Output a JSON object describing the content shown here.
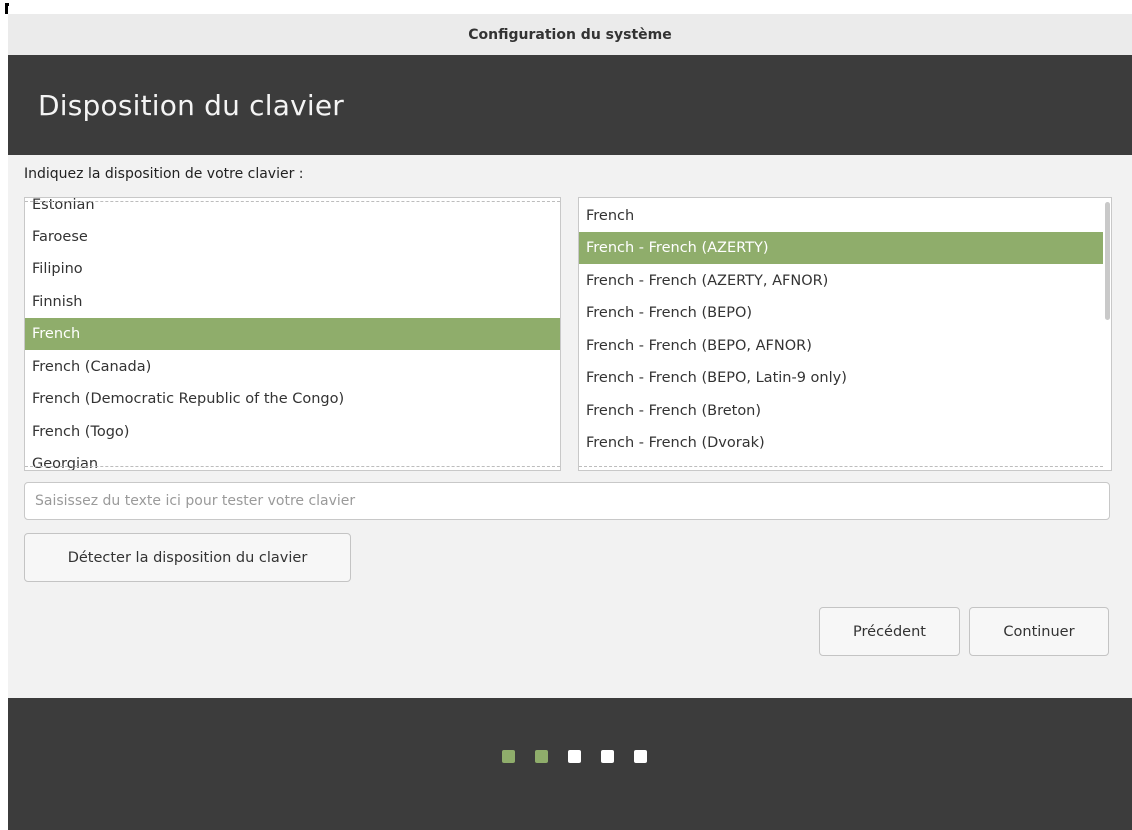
{
  "window": {
    "title": "Configuration du système"
  },
  "header": {
    "title": "Disposition du clavier"
  },
  "prompt": "Indiquez la disposition de votre clavier :",
  "layouts": {
    "items": [
      {
        "label": "Estonian",
        "selected": false
      },
      {
        "label": "Faroese",
        "selected": false
      },
      {
        "label": "Filipino",
        "selected": false
      },
      {
        "label": "Finnish",
        "selected": false
      },
      {
        "label": "French",
        "selected": true
      },
      {
        "label": "French (Canada)",
        "selected": false
      },
      {
        "label": "French (Democratic Republic of the Congo)",
        "selected": false
      },
      {
        "label": "French (Togo)",
        "selected": false
      },
      {
        "label": "Georgian",
        "selected": false
      }
    ]
  },
  "variants": {
    "items": [
      {
        "label": "French",
        "selected": false
      },
      {
        "label": "French - French (AZERTY)",
        "selected": true
      },
      {
        "label": "French - French (AZERTY, AFNOR)",
        "selected": false
      },
      {
        "label": "French - French (BEPO)",
        "selected": false
      },
      {
        "label": "French - French (BEPO, AFNOR)",
        "selected": false
      },
      {
        "label": "French - French (BEPO, Latin-9 only)",
        "selected": false
      },
      {
        "label": "French - French (Breton)",
        "selected": false
      },
      {
        "label": "French - French (Dvorak)",
        "selected": false
      }
    ]
  },
  "test_field": {
    "value": "",
    "placeholder": "Saisissez du texte ici pour tester votre clavier"
  },
  "buttons": {
    "detect": "Détecter la disposition du clavier",
    "previous": "Précédent",
    "continue": "Continuer"
  },
  "progress": {
    "total_steps": 5,
    "completed_steps": 2
  },
  "colors": {
    "accent": "#8fad6b",
    "header_bg": "#3c3c3c",
    "window_bg": "#f2f2f2"
  }
}
